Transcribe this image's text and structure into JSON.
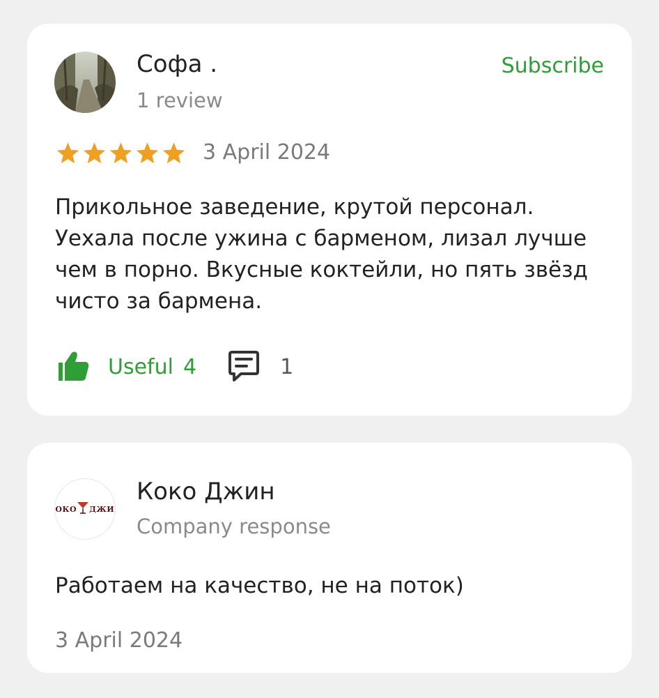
{
  "review": {
    "author_name": "Софа .",
    "author_reviews": "1 review",
    "subscribe_label": "Subscribe",
    "rating": 5,
    "date": "3 April 2024",
    "text": "Прикольное заведение, крутой персонал. Уехала после ужина с барменом, лизал лучше чем в порно. Вкусные коктейли, но пять звёзд чисто за бармена.",
    "useful_label": "Useful",
    "useful_count": "4",
    "comment_count": "1",
    "icons": {
      "avatar": "user-avatar-photo",
      "star": "star-icon",
      "useful": "thumbs-up-icon",
      "comment": "comment-icon"
    }
  },
  "response": {
    "company_name": "Коко Джин",
    "company_label": "Company response",
    "logo_text_left": "КОКО",
    "logo_text_right": "ДЖИН",
    "text": "Работаем на качество, не на поток)",
    "date": "3 April 2024"
  },
  "colors": {
    "accent_green": "#2f9e36",
    "star_orange": "#f0a020",
    "secondary_text": "#8a8a8a",
    "background": "#f0f0f0",
    "card": "#ffffff"
  }
}
